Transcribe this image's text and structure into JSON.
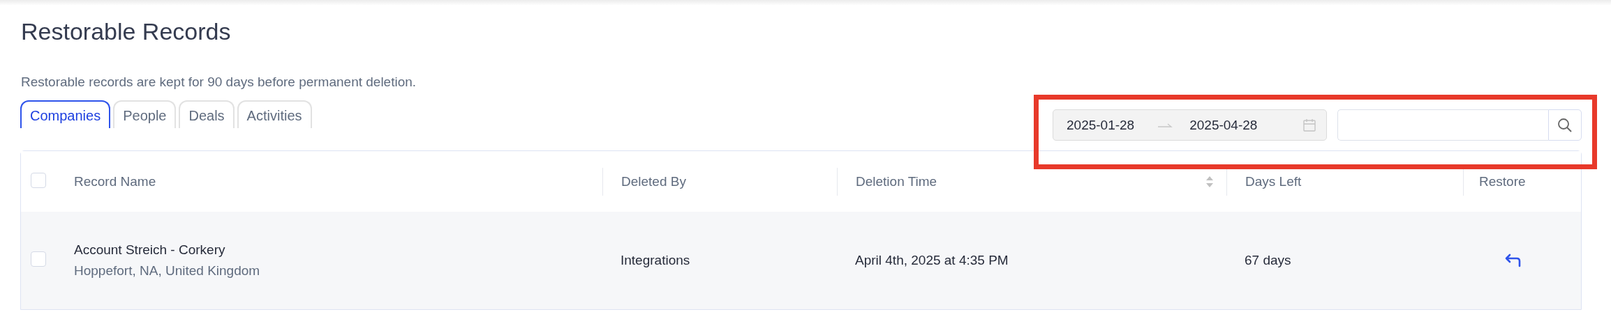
{
  "page": {
    "title": "Restorable Records",
    "description": "Restorable records are kept for 90 days before permanent deletion."
  },
  "tabs": [
    {
      "label": "Companies",
      "selected": true
    },
    {
      "label": "People",
      "selected": false
    },
    {
      "label": "Deals",
      "selected": false
    },
    {
      "label": "Activities",
      "selected": false
    }
  ],
  "date_range": {
    "start": "2025-01-28",
    "end": "2025-04-28"
  },
  "table": {
    "select_all": {
      "checked": false
    },
    "columns": [
      {
        "label": "Record Name",
        "sortable": false
      },
      {
        "label": "Deleted By",
        "sortable": false
      },
      {
        "label": "Deletion Time",
        "sortable": true
      },
      {
        "label": "Days Left",
        "sortable": false
      },
      {
        "label": "Restore",
        "sortable": false
      }
    ],
    "rows": [
      {
        "checked": false,
        "name": "Account Streich - Corkery",
        "location": "Hoppefort, NA, United Kingdom",
        "deleted_by": "Integrations",
        "deletion_time": "April 4th, 2025 at 4:35 PM",
        "days_left": "67 days"
      }
    ]
  }
}
